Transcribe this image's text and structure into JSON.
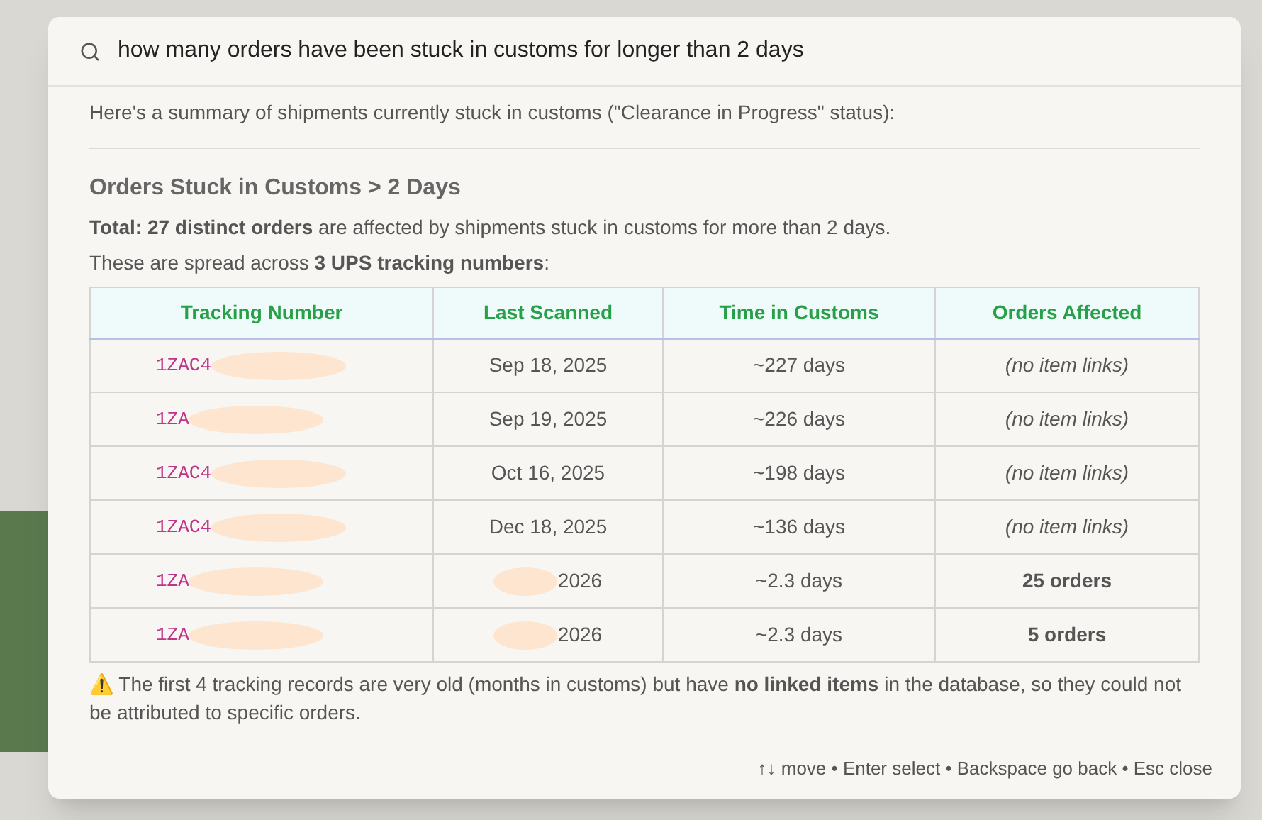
{
  "search": {
    "value": "how many orders have been stuck in customs for longer than 2 days"
  },
  "intro": "Here's a summary of shipments currently stuck in customs (\"Clearance in Progress\" status):",
  "heading": "Orders Stuck in Customs > 2 Days",
  "summary": "**Total: 27 distinct orders** are affected by shipments stuck in customs for more than 2 days.",
  "spread": "These are spread across **3 UPS tracking numbers**:",
  "table": {
    "columns": [
      "Tracking Number",
      "Last Scanned",
      "Time in Customs",
      "Orders Affected"
    ],
    "rows": [
      {
        "tracking": "1ZAC4",
        "last_scanned": "Sep 18, 2025",
        "time": "~227 days",
        "orders": "(no item links)",
        "linked": false
      },
      {
        "tracking": "1ZA",
        "last_scanned": "Sep 19, 2025",
        "time": "~226 days",
        "orders": "(no item links)",
        "linked": false
      },
      {
        "tracking": "1ZAC4",
        "last_scanned": "Oct 16, 2025",
        "time": "~198 days",
        "orders": "(no item links)",
        "linked": false
      },
      {
        "tracking": "1ZAC4",
        "last_scanned": "Dec 18, 2025",
        "time": "~136 days",
        "orders": "(no item links)",
        "linked": false
      },
      {
        "tracking": "1ZA",
        "last_scanned": "2026",
        "time": "~2.3 days",
        "orders": "25 orders",
        "linked": true
      },
      {
        "tracking": "1ZA",
        "last_scanned": "2026",
        "time": "~2.3 days",
        "orders": "5 orders",
        "linked": true
      }
    ]
  },
  "note": {
    "icon": "⚠️",
    "text": "The first 4 tracking records are very old (months in customs) but have **no linked items** in the database, so they could not be attributed to specific orders."
  },
  "footer_hint": "↑↓ move • Enter select • Backspace go back • Esc close"
}
